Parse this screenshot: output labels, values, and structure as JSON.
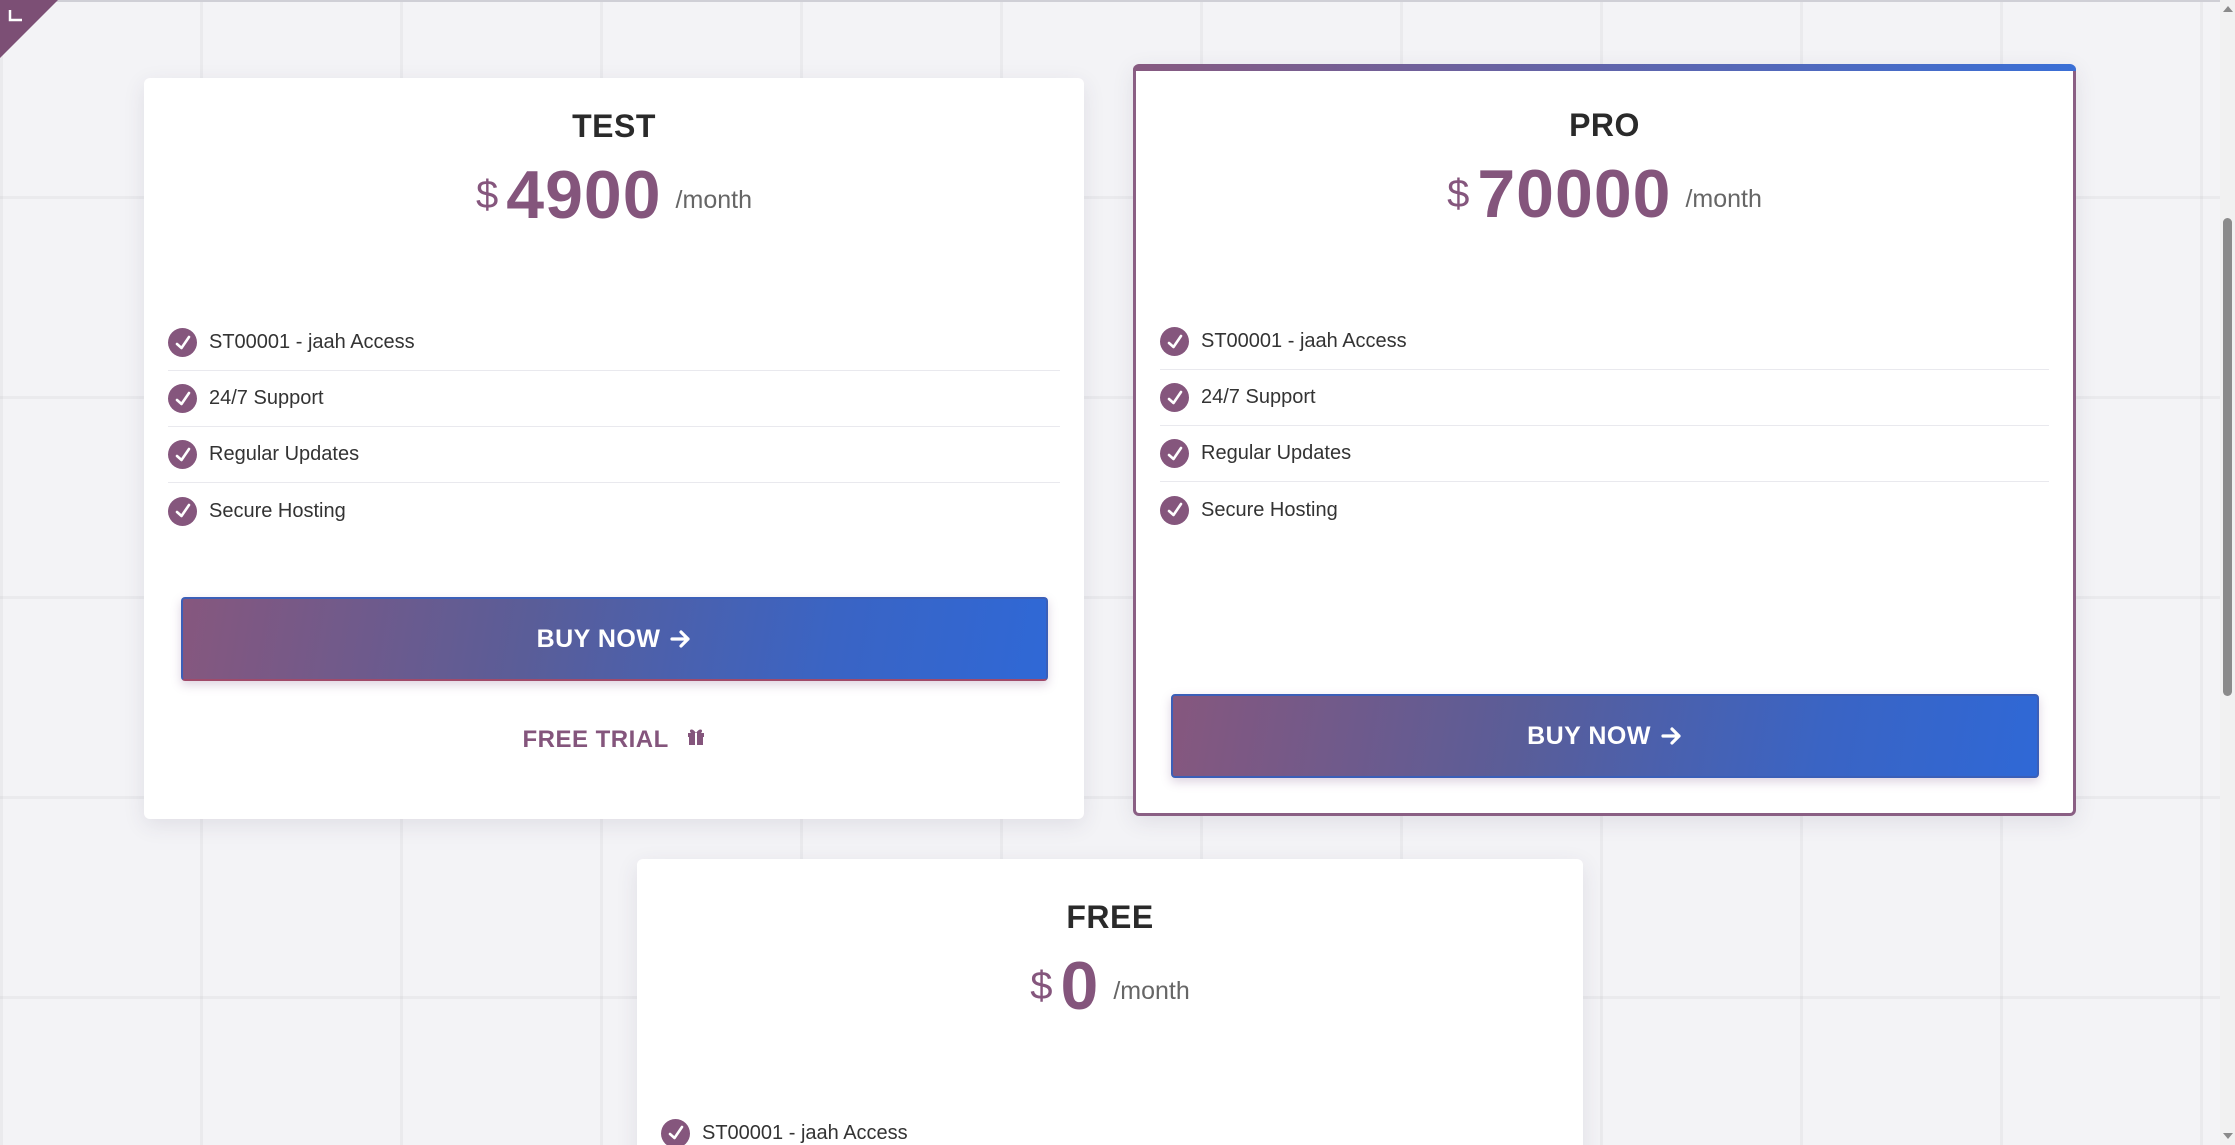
{
  "plans": [
    {
      "name": "TEST",
      "currency": "$",
      "price": "4900",
      "period": "/month",
      "features": [
        "ST00001 - jaah Access",
        "24/7 Support",
        "Regular Updates",
        "Secure Hosting"
      ],
      "buy_label": "BUY NOW",
      "trial_label": "FREE TRIAL"
    },
    {
      "name": "PRO",
      "currency": "$",
      "price": "70000",
      "period": "/month",
      "features": [
        "ST00001 - jaah Access",
        "24/7 Support",
        "Regular Updates",
        "Secure Hosting"
      ],
      "buy_label": "BUY NOW"
    },
    {
      "name": "FREE",
      "currency": "$",
      "price": "0",
      "period": "/month",
      "features": [
        "ST00001 - jaah Access"
      ]
    }
  ],
  "icons": {
    "feature": "check-circle-icon",
    "buy": "arrow-right-icon",
    "trial": "gift-icon",
    "corner": "corner-bracket-icon"
  },
  "colors": {
    "accent": "#84557c",
    "button_start": "#86577e",
    "button_end": "#2f68d6",
    "featured_border": "#8a5f84"
  }
}
